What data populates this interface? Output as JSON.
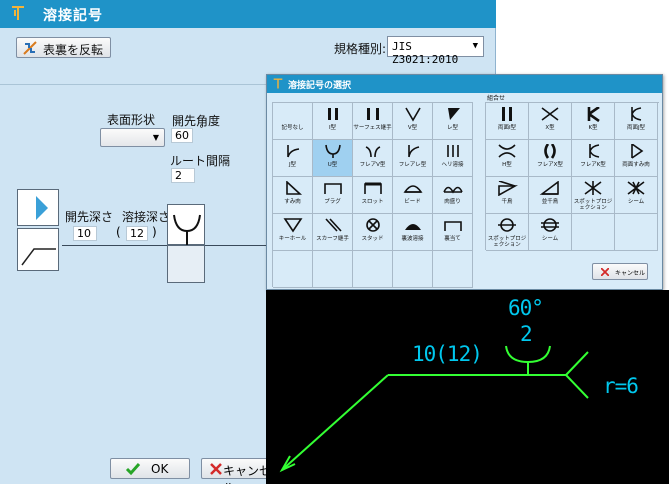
{
  "window": {
    "title": "溶接記号"
  },
  "toolbar": {
    "flip_label": "表裏を反転",
    "standard_label": "規格種別:",
    "standard_value": "JIS Z3021:2010"
  },
  "params": {
    "surface_shape_label": "表面形状",
    "groove_angle_label": "開先角度",
    "groove_angle_value": "60",
    "degree_symbol": "°",
    "root_gap_label": "ルート間隔",
    "root_gap_value": "2",
    "groove_depth_label": "開先深さ",
    "groove_depth_value": "10",
    "weld_depth_label": "溶接深さ",
    "weld_depth_value": "12",
    "paren_open": "(",
    "paren_close": ")"
  },
  "footer": {
    "ok_label": "OK",
    "cancel_label": "キャンセル"
  },
  "popup": {
    "title": "溶接記号の選択",
    "combo_label": "組合せ",
    "cancel_label": "キャンセル",
    "basic_symbols": [
      {
        "label": "記号なし",
        "icon": "none"
      },
      {
        "label": "I型",
        "icon": "i-groove"
      },
      {
        "label": "サーフェス継手",
        "icon": "surface-joint"
      },
      {
        "label": "V型",
        "icon": "v-groove"
      },
      {
        "label": "レ型",
        "icon": "bevel-groove"
      },
      {
        "label": "J型",
        "icon": "j-groove"
      },
      {
        "label": "U型",
        "icon": "u-groove"
      },
      {
        "label": "フレアV型",
        "icon": "flare-v"
      },
      {
        "label": "フレアレ型",
        "icon": "flare-bevel"
      },
      {
        "label": "ヘリ溶接",
        "icon": "edge-weld"
      },
      {
        "label": "すみ肉",
        "icon": "fillet"
      },
      {
        "label": "プラグ",
        "icon": "plug"
      },
      {
        "label": "スロット",
        "icon": "slot"
      },
      {
        "label": "ビード",
        "icon": "bead"
      },
      {
        "label": "肉盛り",
        "icon": "overlay"
      },
      {
        "label": "キーホール",
        "icon": "keyhole"
      },
      {
        "label": "スカーフ継手",
        "icon": "scarf-joint"
      },
      {
        "label": "スタッド",
        "icon": "stud"
      },
      {
        "label": "裏波溶接",
        "icon": "back-bead"
      },
      {
        "label": "裏当て",
        "icon": "backing"
      },
      {
        "label": "",
        "icon": ""
      },
      {
        "label": "",
        "icon": ""
      },
      {
        "label": "",
        "icon": ""
      },
      {
        "label": "",
        "icon": ""
      },
      {
        "label": "",
        "icon": ""
      }
    ],
    "combo_symbols": [
      {
        "label": "両面I型",
        "icon": "double-i"
      },
      {
        "label": "X型",
        "icon": "x-groove"
      },
      {
        "label": "K型",
        "icon": "k-groove"
      },
      {
        "label": "両面J型",
        "icon": "double-j"
      },
      {
        "label": "H型",
        "icon": "h-groove"
      },
      {
        "label": "フレアX型",
        "icon": "flare-x"
      },
      {
        "label": "フレアK型",
        "icon": "flare-k"
      },
      {
        "label": "両面すみ肉",
        "icon": "double-fillet"
      },
      {
        "label": "千鳥",
        "icon": "staggered"
      },
      {
        "label": "並千鳥",
        "icon": "parallel-staggered"
      },
      {
        "label": "スポットプロジェクション",
        "icon": "spot-projection"
      },
      {
        "label": "シーム",
        "icon": "seam"
      },
      {
        "label": "スポットプロジェクション",
        "icon": "spot-projection-2"
      },
      {
        "label": "シーム",
        "icon": "seam-2"
      },
      {
        "label": "",
        "icon": ""
      },
      {
        "label": "",
        "icon": ""
      }
    ]
  },
  "preview": {
    "angle": "60°",
    "root_gap": "2",
    "depth_text": "10(12)",
    "radius": "r=6"
  },
  "colors": {
    "title_bar": "#1f93c8",
    "dialog_bg": "#cfe4f3",
    "popup_bg": "#d8ebf8",
    "selected": "#9fd0f0",
    "preview_text": "#00c8ee",
    "preview_line": "#33ff33"
  }
}
